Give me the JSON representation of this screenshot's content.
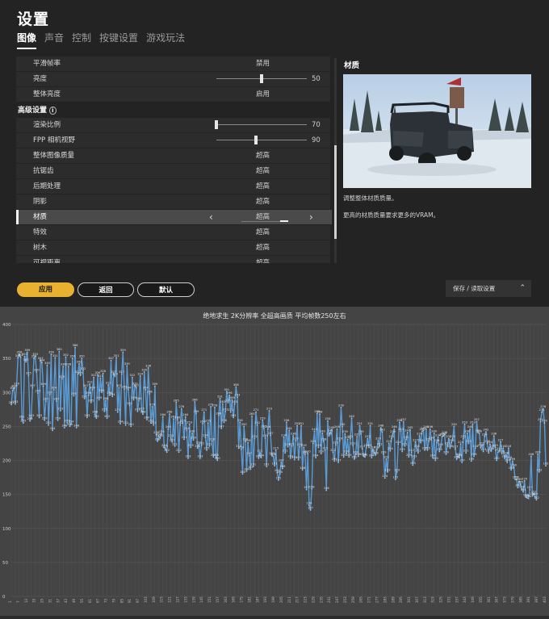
{
  "settings": {
    "title": "设置",
    "tabs": [
      "图像",
      "声音",
      "控制",
      "按键设置",
      "游戏玩法"
    ],
    "rows": [
      {
        "label": "平滑帧率",
        "value": "禁用"
      },
      {
        "label": "亮度",
        "slider": 50
      },
      {
        "label": "整体亮度",
        "value": "启用"
      },
      {
        "section": "高级设置"
      },
      {
        "label": "渲染比例",
        "slider": 70
      },
      {
        "label": "FPP 相机视野",
        "slider": 90
      },
      {
        "label": "整体图像质量",
        "value": "超高"
      },
      {
        "label": "抗锯齿",
        "value": "超高"
      },
      {
        "label": "后期处理",
        "value": "超高"
      },
      {
        "label": "阴影",
        "value": "超高"
      },
      {
        "label": "材质",
        "value": "超高",
        "selected": true
      },
      {
        "label": "特效",
        "value": "超高"
      },
      {
        "label": "树木",
        "value": "超高"
      },
      {
        "label": "可视距离",
        "value": "超高"
      }
    ],
    "panel": {
      "title": "材质",
      "desc1": "调整整体材质质量。",
      "desc2": "更高的材质质量要求更多的VRAM。"
    },
    "buttons": {
      "apply": "应用",
      "back": "返回",
      "default": "默认",
      "saveload": "保存 / 读取设置"
    }
  },
  "chart_data": {
    "type": "line",
    "title": "绝地求生 2K分辨率 全超高画质 平均帧数250左右",
    "ylim": [
      0,
      400
    ],
    "yticks": [
      0,
      50,
      100,
      150,
      200,
      250,
      300,
      350,
      400
    ],
    "grid": true,
    "color": "#5b9bd5",
    "values": [
      282,
      303,
      306,
      283,
      310,
      351,
      356,
      352,
      261,
      255,
      353,
      345,
      359,
      325,
      258,
      263,
      307,
      350,
      353,
      330,
      299,
      263,
      347,
      344,
      309,
      259,
      287,
      340,
      252,
      297,
      356,
      244,
      304,
      351,
      287,
      259,
      360,
      273,
      320,
      338,
      248,
      352,
      255,
      338,
      250,
      254,
      350,
      295,
      366,
      248,
      327,
      342,
      325,
      350,
      332,
      291,
      307,
      263,
      296,
      312,
      285,
      304,
      322,
      268,
      262,
      326,
      289,
      321,
      300,
      328,
      272,
      288,
      262,
      311,
      296,
      347,
      294,
      327,
      324,
      351,
      271,
      307,
      254,
      327,
      359,
      305,
      252,
      339,
      304,
      281,
      250,
      322,
      289,
      310,
      307,
      272,
      288,
      324,
      273,
      268,
      330,
      304,
      260,
      336,
      298,
      255,
      279,
      252,
      309,
      238,
      228,
      235,
      233,
      239,
      264,
      219,
      217,
      212,
      246,
      268,
      233,
      227,
      261,
      221,
      285,
      260,
      212,
      252,
      276,
      255,
      231,
      264,
      244,
      203,
      253,
      219,
      240,
      230,
      286,
      269,
      218,
      223,
      203,
      222,
      254,
      271,
      234,
      215,
      255,
      221,
      279,
      228,
      205,
      278,
      205,
      200,
      266,
      291,
      247,
      283,
      256,
      272,
      301,
      285,
      296,
      271,
      289,
      263,
      283,
      308,
      293,
      218,
      256,
      216,
      180,
      250,
      228,
      184,
      226,
      207,
      187,
      265,
      191,
      232,
      271,
      252,
      203,
      211,
      204,
      259,
      247,
      233,
      191,
      246,
      273,
      237,
      207,
      206,
      192,
      215,
      182,
      171,
      180,
      197,
      188,
      234,
      211,
      256,
      220,
      244,
      203,
      221,
      236,
      201,
      229,
      251,
      201,
      220,
      251,
      186,
      219,
      209,
      157,
      210,
      134,
      127,
      158,
      225,
      243,
      204,
      269,
      219,
      268,
      210,
      240,
      228,
      215,
      156,
      258,
      236,
      241,
      245,
      212,
      199,
      223,
      246,
      197,
      229,
      278,
      250,
      205,
      239,
      210,
      231,
      205,
      232,
      262,
      222,
      202,
      209,
      235,
      206,
      251,
      239,
      217,
      206,
      205,
      219,
      232,
      219,
      251,
      204,
      216,
      211,
      208,
      216,
      229,
      221,
      248,
      242,
      209,
      174,
      202,
      183,
      225,
      214,
      232,
      239,
      246,
      172,
      183,
      224,
      256,
      243,
      213,
      257,
      221,
      231,
      241,
      205,
      245,
      212,
      193,
      203,
      227,
      218,
      211,
      236,
      226,
      243,
      244,
      215,
      246,
      215,
      228,
      246,
      230,
      204,
      240,
      200,
      226,
      234,
      213,
      220,
      235,
      236,
      238,
      209,
      222,
      232,
      218,
      226,
      232,
      250,
      217,
      202,
      206,
      204,
      224,
      197,
      232,
      253,
      211,
      240,
      225,
      246,
      199,
      253,
      206,
      218,
      257,
      241,
      240,
      219,
      222,
      213,
      235,
      242,
      225,
      211,
      224,
      214,
      218,
      236,
      219,
      200,
      212,
      214,
      227,
      210,
      218,
      203,
      208,
      197,
      218,
      201,
      186,
      199,
      190,
      172,
      172,
      160,
      169,
      165,
      158,
      154,
      170,
      146,
      145,
      144,
      157,
      206,
      148,
      151,
      147,
      142,
      209,
      183,
      257,
      271,
      276,
      255,
      192
    ]
  }
}
